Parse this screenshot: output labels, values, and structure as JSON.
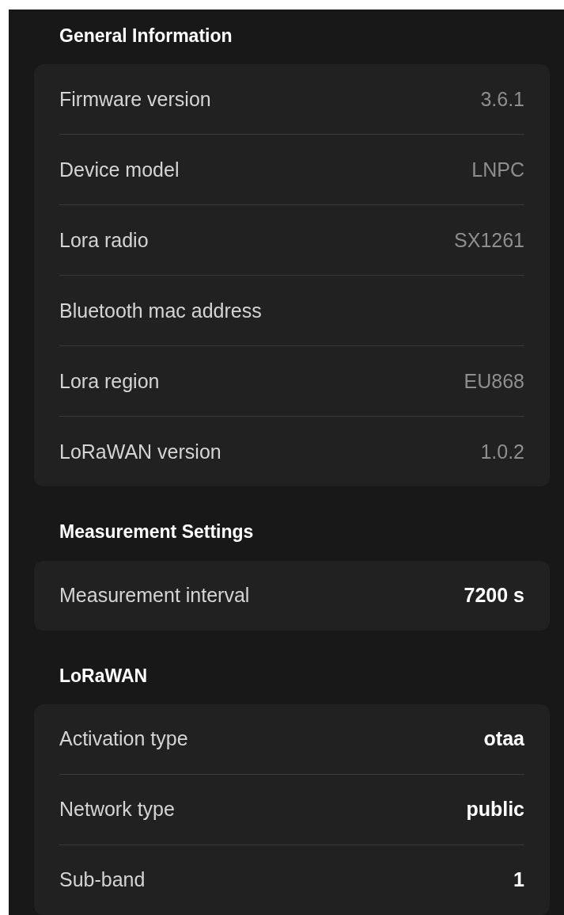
{
  "sections": [
    {
      "title": "General Information",
      "rows": [
        {
          "label": "Firmware version",
          "value": "3.6.1",
          "kind": "readonly"
        },
        {
          "label": "Device model",
          "value": "LNPC",
          "kind": "readonly"
        },
        {
          "label": "Lora radio",
          "value": "SX1261",
          "kind": "readonly"
        },
        {
          "label": "Bluetooth mac address"
        },
        {
          "label": "Lora region",
          "value": "EU868",
          "kind": "readonly"
        },
        {
          "label": "LoRaWAN version",
          "value": "1.0.2",
          "kind": "readonly"
        }
      ]
    },
    {
      "title": "Measurement Settings",
      "rows": [
        {
          "label": "Measurement interval",
          "value": "7200 s",
          "kind": "editable"
        }
      ]
    },
    {
      "title": "LoRaWAN",
      "rows": [
        {
          "label": "Activation type",
          "value": "otaa",
          "kind": "editable"
        },
        {
          "label": "Network type",
          "value": "public",
          "kind": "editable"
        },
        {
          "label": "Sub-band",
          "value": "1",
          "kind": "editable"
        }
      ]
    }
  ]
}
